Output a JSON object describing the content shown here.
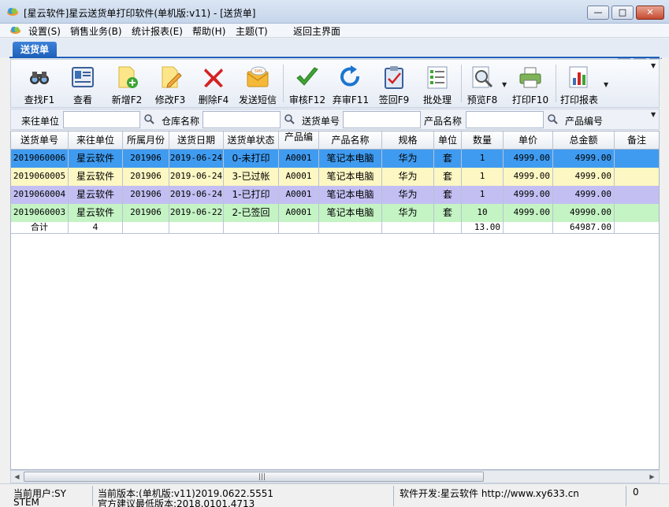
{
  "window": {
    "title": "[星云软件]星云送货单打印软件(单机版:v11) - [送货单]",
    "min_symbol": "—",
    "max_symbol": "□",
    "close_symbol": "✕"
  },
  "menu": {
    "items": [
      "设置(S)",
      "销售业务(B)",
      "统计报表(E)",
      "帮助(H)",
      "主题(T)",
      "返回主界面"
    ],
    "mdi_min": "–",
    "mdi_restore": "❐",
    "mdi_close": "×"
  },
  "tab": {
    "label": "送货单"
  },
  "toolbar": {
    "find": "查找F1",
    "view": "查看",
    "add": "新增F2",
    "edit": "修改F3",
    "delete": "删除F4",
    "sms": "发送短信",
    "approve": "审核F12",
    "unapprove": "弃审F11",
    "signback": "签回F9",
    "batch": "批处理",
    "preview": "预览F8",
    "print": "打印F10",
    "report": "打印报表",
    "sms_icon_text": "SMS"
  },
  "search": {
    "customer_label": "来往单位",
    "warehouse_label": "仓库名称",
    "order_no_label": "送货单号",
    "product_name_label": "产品名称",
    "product_code_label": "产品编号",
    "customer_value": "",
    "warehouse_value": "",
    "order_no_value": "",
    "product_name_value": ""
  },
  "table": {
    "columns": [
      "送货单号",
      "来往单位",
      "所属月份",
      "送货日期",
      "送货单状态",
      "产品编",
      "产品名称",
      "规格",
      "单位",
      "数量",
      "单价",
      "总金额",
      "备注"
    ],
    "rows": [
      [
        "2019060006",
        "星云软件",
        "201906",
        "2019-06-24",
        "0-未打印",
        "A0001",
        "笔记本电脑",
        "华为",
        "套",
        "1",
        "4999.00",
        "4999.00",
        ""
      ],
      [
        "2019060005",
        "星云软件",
        "201906",
        "2019-06-24",
        "3-已过帐",
        "A0001",
        "笔记本电脑",
        "华为",
        "套",
        "1",
        "4999.00",
        "4999.00",
        ""
      ],
      [
        "2019060004",
        "星云软件",
        "201906",
        "2019-06-24",
        "1-已打印",
        "A0001",
        "笔记本电脑",
        "华为",
        "套",
        "1",
        "4999.00",
        "4999.00",
        ""
      ],
      [
        "2019060003",
        "星云软件",
        "201906",
        "2019-06-22",
        "2-已签回",
        "A0001",
        "笔记本电脑",
        "华为",
        "套",
        "10",
        "4999.00",
        "49990.00",
        ""
      ]
    ],
    "row_colors": [
      "#3f9bf0",
      "#fdf7c3",
      "#c3bff3",
      "#c4f3c4"
    ],
    "summary": {
      "label": "合计",
      "count": "4",
      "qty": "13.00",
      "total": "64987.00"
    }
  },
  "statusbar": {
    "user": "当前用户:SY",
    "user2": "STEM",
    "version": "当前版本:(单机版:v11)2019.0622.5551",
    "version2": "官方建议最低版本:2018.0101.4713",
    "developer": "软件开发:星云软件 http://www.xy633.cn",
    "count": "0"
  },
  "scrollbar": {
    "left": "◀",
    "right": "▶",
    "grip": "|||"
  }
}
